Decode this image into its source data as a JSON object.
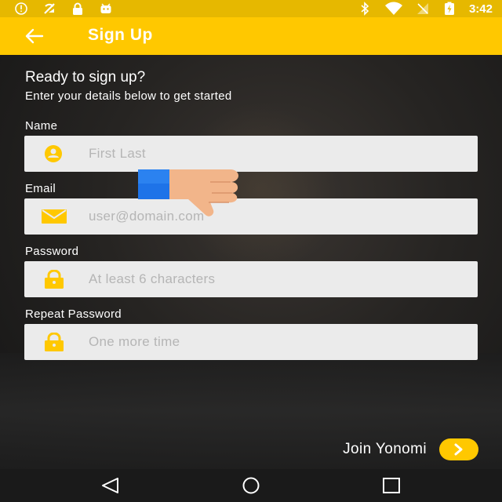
{
  "status_bar": {
    "time": "3:42",
    "left_icons": [
      "alert-icon",
      "no-signal-icon",
      "lock-icon",
      "android-icon"
    ],
    "right_icons": [
      "bluetooth-icon",
      "wifi-icon",
      "signal-icon",
      "battery-icon"
    ]
  },
  "app_bar": {
    "title": "Sign Up",
    "back_icon": "arrow-back-icon",
    "color": "#ffc800"
  },
  "intro": {
    "heading": "Ready to sign up?",
    "subheading": "Enter your details below to get started"
  },
  "form": {
    "fields": [
      {
        "label": "Name",
        "placeholder": "First Last",
        "icon": "person-icon"
      },
      {
        "label": "Email",
        "placeholder": "user@domain.com",
        "icon": "mail-icon"
      },
      {
        "label": "Password",
        "placeholder": "At least 6 characters",
        "icon": "lock-icon"
      },
      {
        "label": "Repeat Password",
        "placeholder": "One more time",
        "icon": "lock-icon"
      }
    ]
  },
  "join": {
    "label": "Join Yonomi",
    "icon": "chevron-right-icon"
  },
  "nav_bar": {
    "buttons": [
      "back-triangle-icon",
      "home-circle-icon",
      "recents-square-icon"
    ]
  },
  "overlay": {
    "icon": "thumbs-down-hand-icon"
  }
}
